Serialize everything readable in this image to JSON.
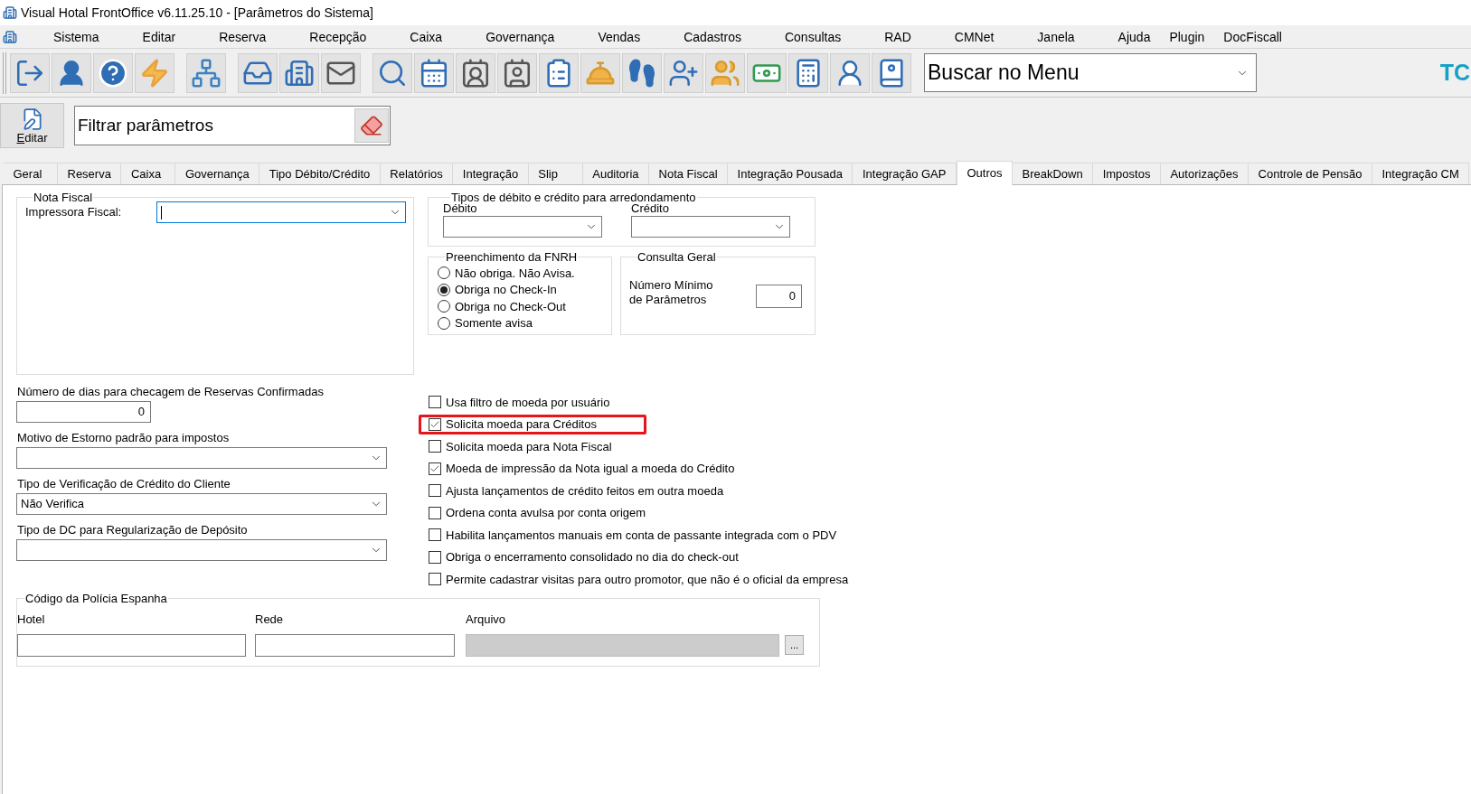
{
  "window": {
    "title": "Visual Hotal FrontOffice v6.11.25.10 - [Parâmetros do Sistema]"
  },
  "menu_bar": {
    "items": [
      "Sistema",
      "Editar",
      "Reserva",
      "Recepção",
      "Caixa",
      "Governança",
      "Vendas",
      "Cadastros",
      "Consultas",
      "RAD",
      "CMNet",
      "Janela",
      "Ajuda",
      "Plugin",
      "DocFiscall"
    ]
  },
  "toolbar": {
    "menu_search": {
      "value": "Buscar no Menu"
    },
    "logo_text": "TC"
  },
  "filter_bar": {
    "edit_button": "Editar",
    "filter": {
      "value": "Filtrar parâmetros"
    }
  },
  "tabs": [
    {
      "label": "Geral",
      "selected": false
    },
    {
      "label": "Reserva",
      "selected": false
    },
    {
      "label": "Caixa",
      "selected": false
    },
    {
      "label": "Governança",
      "selected": false
    },
    {
      "label": "Tipo Débito/Crédito",
      "selected": false
    },
    {
      "label": "Relatórios",
      "selected": false
    },
    {
      "label": "Integração",
      "selected": false
    },
    {
      "label": "Slip",
      "selected": false
    },
    {
      "label": "Auditoria",
      "selected": false
    },
    {
      "label": "Nota Fiscal",
      "selected": false
    },
    {
      "label": "Integração Pousada",
      "selected": false
    },
    {
      "label": "Integração GAP",
      "selected": false
    },
    {
      "label": "Outros",
      "selected": true
    },
    {
      "label": "BreakDown",
      "selected": false
    },
    {
      "label": "Impostos",
      "selected": false
    },
    {
      "label": "Autorizações",
      "selected": false
    },
    {
      "label": "Controle de Pensão",
      "selected": false
    },
    {
      "label": "Integração CM",
      "selected": false
    }
  ],
  "nota_fiscal": {
    "title": "Nota Fiscal",
    "field": {
      "label": "Impressora Fiscal:",
      "focused": true
    }
  },
  "fields": [
    {
      "kind": "number",
      "label": "Número de dias para checagem de Reservas Confirmadas",
      "value": "0"
    },
    {
      "kind": "combo",
      "label": "Motivo de Estorno padrão para impostos"
    },
    {
      "kind": "combo",
      "label": "Tipo de Verificação de Crédito do Cliente",
      "value": "Não Verifica"
    },
    {
      "kind": "combo",
      "label": "Tipo de DC para Regularização de Depósito"
    }
  ],
  "arredondamento": {
    "title": "Tipos de débito e crédito para arredondamento",
    "fields": [
      {
        "label": "Débito"
      },
      {
        "label": "Crédito"
      }
    ]
  },
  "fnrh": {
    "title": "Preenchimento da FNRH",
    "options": [
      {
        "label": "Não obriga. Não Avisa.",
        "selected": false
      },
      {
        "label": "Obriga no Check-In",
        "selected": true
      },
      {
        "label": "Obriga no Check-Out",
        "selected": false
      },
      {
        "label": "Somente avisa",
        "selected": false
      }
    ]
  },
  "consulta_geral": {
    "title": "Consulta Geral",
    "label": "Número Mínimo de Parâmetros",
    "value": "0"
  },
  "checkboxes": [
    {
      "label": "Usa filtro de moeda por usuário",
      "checked": false,
      "highlighted": false
    },
    {
      "label": "Solicita moeda para Créditos",
      "checked": true,
      "highlighted": true
    },
    {
      "label": "Solicita moeda para Nota Fiscal",
      "checked": false,
      "highlighted": false
    },
    {
      "label": "Moeda de impressão da Nota igual a moeda do Crédito",
      "checked": true,
      "highlighted": false
    },
    {
      "label": "Ajusta lançamentos de crédito feitos em outra moeda",
      "checked": false,
      "highlighted": false
    },
    {
      "label": "Ordena conta avulsa por conta origem",
      "checked": false,
      "highlighted": false
    },
    {
      "label": "Habilita lançamentos manuais em conta de passante integrada com o PDV",
      "checked": false,
      "highlighted": false
    },
    {
      "label": "Obriga o encerramento consolidado no dia do check-out",
      "checked": false,
      "highlighted": false
    },
    {
      "label": "Permite cadastrar visitas para outro promotor, que não é o oficial da empresa",
      "checked": false,
      "highlighted": false
    }
  ],
  "policia_espanha": {
    "title": "Código da Polícia Espanha",
    "fields": [
      {
        "label": "Hotel",
        "disabled": false
      },
      {
        "label": "Rede",
        "disabled": false
      },
      {
        "label": "Arquivo",
        "disabled": true,
        "button": "..."
      }
    ]
  }
}
